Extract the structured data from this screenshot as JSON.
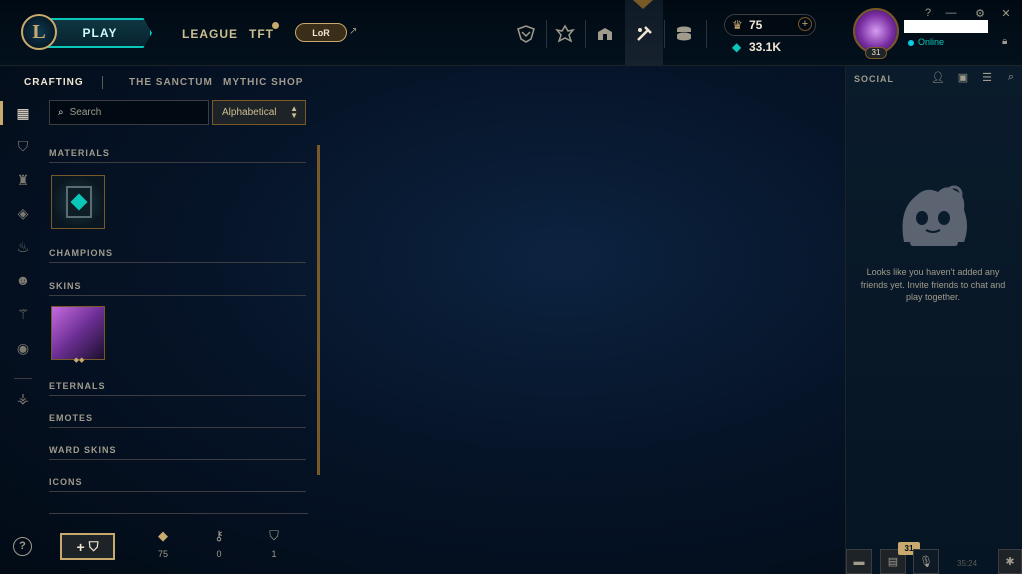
{
  "header": {
    "logo_letter": "L",
    "play_label": "PLAY",
    "nav": [
      "LEAGUE",
      "TFT"
    ],
    "lor_label": "LoR",
    "lor_arrow": "↗",
    "currency": {
      "blue_essence": "75",
      "riot_points": "33.1K",
      "add_label": "+"
    },
    "profile": {
      "level": "31",
      "status": "Online"
    },
    "window_controls": [
      "?",
      "—",
      "✕"
    ]
  },
  "subnav": {
    "tabs": [
      "CRAFTING",
      "THE SANCTUM",
      "MYTHIC SHOP"
    ],
    "active": "CRAFTING"
  },
  "crafting": {
    "search_placeholder": "Search",
    "sort_value": "Alphabetical",
    "sections": [
      "MATERIALS",
      "CHAMPIONS",
      "SKINS",
      "ETERNALS",
      "EMOTES",
      "WARD SKINS",
      "ICONS"
    ],
    "add_chest_label": "+",
    "counters": [
      {
        "icon": "essence-icon",
        "value": "75"
      },
      {
        "icon": "key-icon",
        "value": "0"
      },
      {
        "icon": "chest-icon",
        "value": "1"
      }
    ]
  },
  "left_rail": {
    "help": "?",
    "items": [
      "all-icon",
      "chest-icon",
      "champion-icon",
      "skin-icon",
      "eternal-icon",
      "emote-icon",
      "ward-icon",
      "profile-icon-icon",
      "misc-icon"
    ]
  },
  "social": {
    "title": "SOCIAL",
    "empty_message": "Looks like you haven't added any friends yet. Invite friends to chat and play together.",
    "dock_badge": "31",
    "dock_time": "35:24"
  },
  "colors": {
    "gold": "#c8aa6e",
    "teal": "#0ac8b9",
    "background": "#010a13"
  }
}
